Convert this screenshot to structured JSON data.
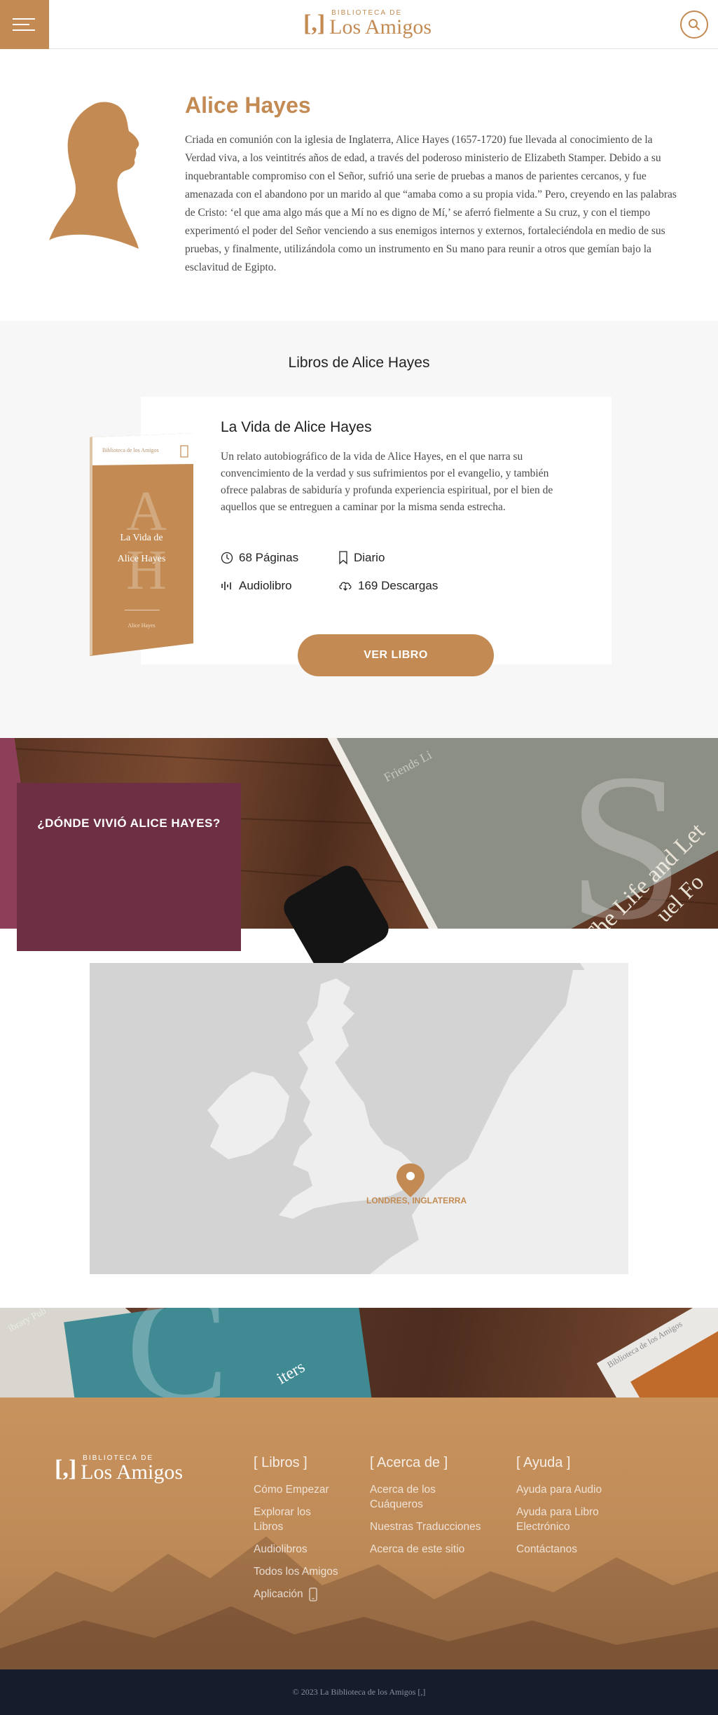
{
  "header": {
    "logo_small": "BIBLIOTECA DE",
    "logo_big": "Los Amigos",
    "logo_mark": "[,]"
  },
  "author": {
    "name": "Alice Hayes",
    "bio": "Criada en comunión con la iglesia de Inglaterra, Alice Hayes (1657-1720) fue llevada al conocimiento de la Verdad viva, a los veintitrés años de edad, a través del poderoso ministerio de Elizabeth Stamper. Debido a su inquebrantable compromiso con el Señor, sufrió una serie de pruebas a manos de parientes cercanos, y fue amenazada con el abandono por un marido al que “amaba como a su propia vida.” Pero, creyendo en las palabras de Cristo: ‘el que ama algo más que a Mí no es digno de Mí,’ se aferró fielmente a Su cruz, y con el tiempo experimentó el poder del Señor venciendo a sus enemigos internos y externos, fortaleciéndola en medio de sus pruebas, y finalmente, utilizándola como un instrumento en Su mano para reunir a otros que gemían bajo la esclavitud de Egipto."
  },
  "books": {
    "heading": "Libros de Alice Hayes",
    "items": [
      {
        "title": "La Vida de Alice Hayes",
        "description": "Un relato autobiográfico de la vida de Alice Hayes, en el que narra su convencimiento de la verdad y sus sufrimientos por el evangelio, y también ofrece palabras de sabiduría y profunda experiencia espiritual, por el bien de aquellos que se entreguen a caminar por la misma senda estrecha.",
        "pages": "68 Páginas",
        "type": "Diario",
        "audio": "Audiolibro",
        "downloads": "169 Descargas",
        "button": "VER LIBRO",
        "cover": {
          "series": "Biblioteca de los Amigos",
          "title_line1": "La Vida de",
          "title_line2": "Alice Hayes",
          "initials": "AH",
          "author": "Alice Hayes",
          "mark": "[,]"
        }
      }
    ]
  },
  "map_section": {
    "title": "¿DÓNDE VIVIÓ ALICE HAYES?",
    "location": "LONDRES, INGLATERRA"
  },
  "banner_texts": {
    "book1": "Friends Li",
    "book2": "The Life and Let",
    "book3": "uel Fo",
    "book4": "iters",
    "book5": "Biblioteca de los Amigos",
    "book6": "ibrary Pub"
  },
  "footer": {
    "logo_small": "BIBLIOTECA DE",
    "logo_big": "Los Amigos",
    "columns": [
      {
        "title": "[ Libros ]",
        "links": [
          "Cómo Empezar",
          "Explorar los Libros",
          "Audiolibros",
          "Todos los Amigos",
          "Aplicación"
        ]
      },
      {
        "title": "[ Acerca de ]",
        "links": [
          "Acerca de los Cuáqueros",
          "Nuestras Traducciones",
          "Acerca de este sitio"
        ]
      },
      {
        "title": "[ Ayuda ]",
        "links": [
          "Ayuda para Audio",
          "Ayuda para Libro Electrónico",
          "Contáctanos"
        ]
      }
    ],
    "copyright": "© 2023 La Biblioteca de los Amigos [,]"
  },
  "colors": {
    "accent": "#c38b53",
    "map_box": "#6e2f44",
    "copyright_bg": "#161c2c"
  }
}
